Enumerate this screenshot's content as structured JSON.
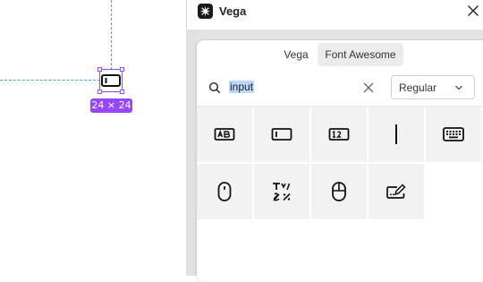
{
  "canvas": {
    "selection_size": "24 × 24"
  },
  "window": {
    "title": "Vega"
  },
  "tabs": [
    {
      "label": "Vega"
    },
    {
      "label": "Font Awesome"
    }
  ],
  "search": {
    "value": "input"
  },
  "style_select": {
    "value": "Regular"
  },
  "colors": {
    "accent": "#9747ff",
    "guide": "#4a9af5",
    "selection_highlight": "#bcd8fb",
    "tab_active_bg": "#ebebeb",
    "cell_bg": "#f2f2f2"
  },
  "icons": [
    "input-text-icon",
    "input-field-icon",
    "input-numeric-icon",
    "i-cursor-icon",
    "keyboard-icon",
    "computer-mouse-icon",
    "text-input-symbols-icon",
    "mouse-icon",
    "input-pen-icon"
  ]
}
